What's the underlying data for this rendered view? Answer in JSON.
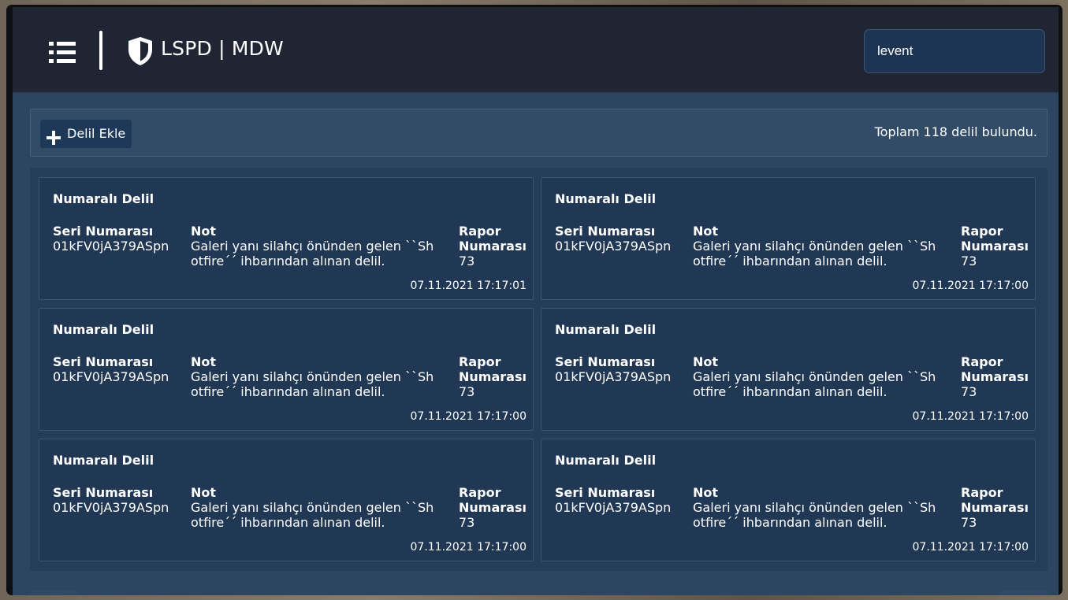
{
  "header": {
    "title": "LSPD | MDW",
    "search_value": "levent"
  },
  "toolbar": {
    "add_label": "Delil Ekle",
    "total_text": "Toplam 118 delil bulundu."
  },
  "labels": {
    "serial": "Seri Numarası",
    "note": "Not",
    "report": "Rapor Numarası"
  },
  "evidence": [
    {
      "title": "Numaralı Delil",
      "serial": "01kFV0jA379ASpn",
      "note": "Galeri yanı silahçı önünden gelen ``Shotfire´´ ihbarından alınan delil.",
      "report": "73",
      "date": "07.11.2021 17:17:01"
    },
    {
      "title": "Numaralı Delil",
      "serial": "01kFV0jA379ASpn",
      "note": "Galeri yanı silahçı önünden gelen ``Shotfire´´ ihbarından alınan delil.",
      "report": "73",
      "date": "07.11.2021 17:17:00"
    },
    {
      "title": "Numaralı Delil",
      "serial": "01kFV0jA379ASpn",
      "note": "Galeri yanı silahçı önünden gelen ``Shotfire´´ ihbarından alınan delil.",
      "report": "73",
      "date": "07.11.2021 17:17:00"
    },
    {
      "title": "Numaralı Delil",
      "serial": "01kFV0jA379ASpn",
      "note": "Galeri yanı silahçı önünden gelen ``Shotfire´´ ihbarından alınan delil.",
      "report": "73",
      "date": "07.11.2021 17:17:00"
    },
    {
      "title": "Numaralı Delil",
      "serial": "01kFV0jA379ASpn",
      "note": "Galeri yanı silahçı önünden gelen ``Shotfire´´ ihbarından alınan delil.",
      "report": "73",
      "date": "07.11.2021 17:17:00"
    },
    {
      "title": "Numaralı Delil",
      "serial": "01kFV0jA379ASpn",
      "note": "Galeri yanı silahçı önünden gelen ``Shotfire´´ ihbarından alınan delil.",
      "report": "73",
      "date": "07.11.2021 17:17:00"
    }
  ],
  "icons": {
    "menu": "list-icon",
    "logo": "shield-icon",
    "add": "plus-icon"
  },
  "colors": {
    "header_bg": "#1f2532",
    "content_bg": "#2c4560",
    "card_bg": "#213855",
    "search_bg": "#1d3553"
  }
}
